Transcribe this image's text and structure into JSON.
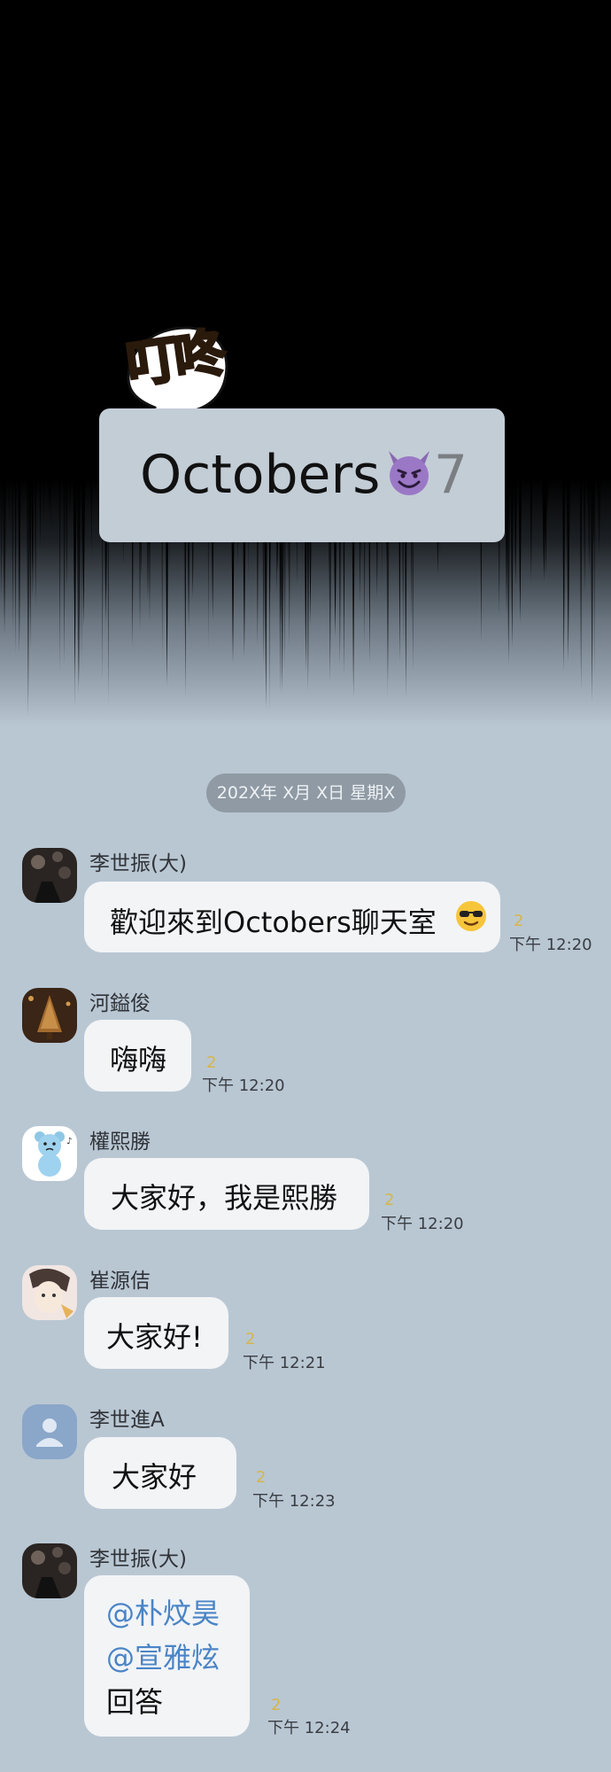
{
  "sound_effect": "叮咚",
  "chat": {
    "name": "Octobers",
    "name_icon": "smiling-devil-icon",
    "member_count": "7"
  },
  "date_divider": "202X年 X月 X日 星期X",
  "messages": [
    {
      "sender": "李世振(大)",
      "avatar": "dark-photo-avatar",
      "lines": [
        "歡迎來到Octobers聊天室"
      ],
      "emoji": "sunglasses-face-icon",
      "unread": "2",
      "time": "下午 12:20"
    },
    {
      "sender": "河鎰俊",
      "avatar": "christmas-tree-avatar",
      "lines": [
        "嗨嗨"
      ],
      "unread": "2",
      "time": "下午 12:20"
    },
    {
      "sender": "權熙勝",
      "avatar": "blue-bear-avatar",
      "lines": [
        "大家好，我是熙勝"
      ],
      "unread": "2",
      "time": "下午 12:20"
    },
    {
      "sender": "崔源佶",
      "avatar": "drawn-face-avatar",
      "lines": [
        "大家好!"
      ],
      "unread": "2",
      "time": "下午 12:21"
    },
    {
      "sender": "李世進A",
      "avatar": "default-person-avatar",
      "lines": [
        "大家好"
      ],
      "unread": "2",
      "time": "下午 12:23"
    },
    {
      "sender": "李世振(大)",
      "avatar": "dark-photo-avatar",
      "mentions": [
        "@朴炆昊",
        "@宣雅炫"
      ],
      "lines": [
        "回答"
      ],
      "unread": "2",
      "time": "下午 12:24"
    }
  ],
  "colors": {
    "background": "#b9c7d3",
    "bubble": "#f2f4f6",
    "mention": "#4a84c6",
    "unread": "#d6b64a",
    "date_pill": "#8f9aa4"
  }
}
